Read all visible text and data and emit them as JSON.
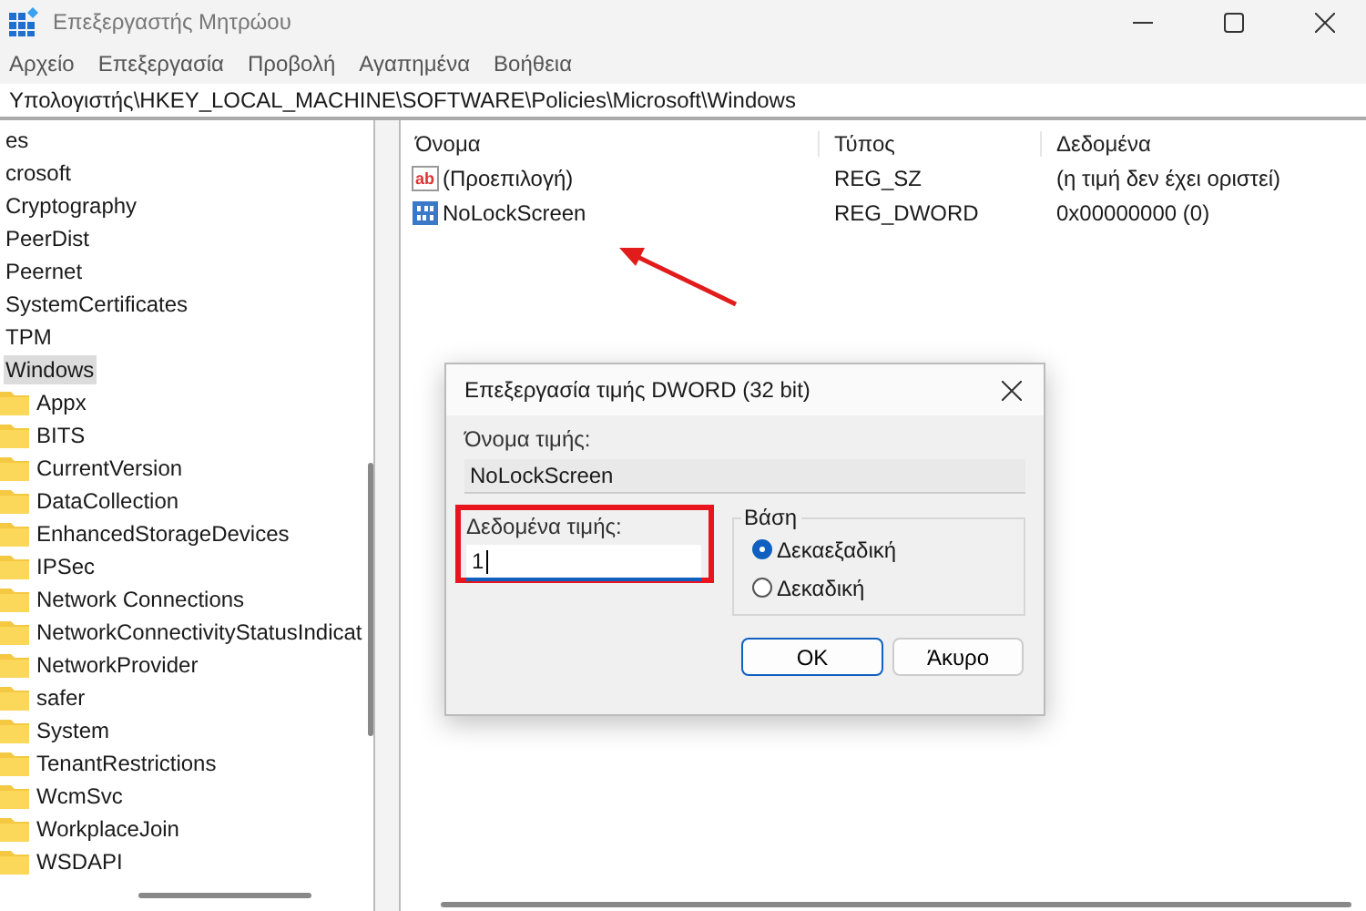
{
  "window": {
    "title": "Επεξεργαστής Μητρώου"
  },
  "menu": [
    "Αρχείο",
    "Επεξεργασία",
    "Προβολή",
    "Αγαπημένα",
    "Βοήθεια"
  ],
  "address": "Υπολογιστής\\HKEY_LOCAL_MACHINE\\SOFTWARE\\Policies\\Microsoft\\Windows",
  "tree": {
    "items": [
      {
        "label": "es",
        "selected": false
      },
      {
        "label": "crosoft",
        "selected": false
      },
      {
        "label": "Cryptography",
        "selected": false
      },
      {
        "label": "PeerDist",
        "selected": false
      },
      {
        "label": "Peernet",
        "selected": false
      },
      {
        "label": "SystemCertificates",
        "selected": false
      },
      {
        "label": "TPM",
        "selected": false
      },
      {
        "label": "Windows",
        "selected": true,
        "children": [
          {
            "label": "Appx",
            "selected": false
          },
          {
            "label": "BITS",
            "selected": false
          },
          {
            "label": "CurrentVersion",
            "selected": false
          },
          {
            "label": "DataCollection",
            "selected": false
          },
          {
            "label": "EnhancedStorageDevices",
            "selected": false
          },
          {
            "label": "IPSec",
            "selected": false
          },
          {
            "label": "Network Connections",
            "selected": false
          },
          {
            "label": "NetworkConnectivityStatusIndicat",
            "selected": false
          },
          {
            "label": "NetworkProvider",
            "selected": false
          },
          {
            "label": "safer",
            "selected": false
          },
          {
            "label": "System",
            "selected": false
          },
          {
            "label": "TenantRestrictions",
            "selected": false
          },
          {
            "label": "WcmSvc",
            "selected": false
          },
          {
            "label": "WorkplaceJoin",
            "selected": false
          },
          {
            "label": "WSDAPI",
            "selected": false
          }
        ]
      }
    ]
  },
  "table": {
    "columns": [
      "Όνομα",
      "Τύπος",
      "Δεδομένα"
    ],
    "rows": [
      {
        "kind": "string",
        "icon_text": "ab",
        "name": "(Προεπιλογή)",
        "type": "REG_SZ",
        "data": "(η τιμή δεν έχει οριστεί)"
      },
      {
        "kind": "binary",
        "name": "NoLockScreen",
        "type": "REG_DWORD",
        "data": "0x00000000 (0)"
      }
    ]
  },
  "dialog": {
    "title": "Επεξεργασία τιμής DWORD (32 bit)",
    "name_label": "Όνομα τιμής:",
    "name_value": "NoLockScreen",
    "data_label": "Δεδομένα τιμής:",
    "data_value": "1",
    "base_label": "Βάση",
    "bases": [
      {
        "label": "Δεκαεξαδική",
        "selected": true
      },
      {
        "label": "Δεκαδική",
        "selected": false
      }
    ],
    "buttons": [
      {
        "label": "OK",
        "default": true
      },
      {
        "label": "Άκυρο",
        "default": false
      }
    ]
  }
}
